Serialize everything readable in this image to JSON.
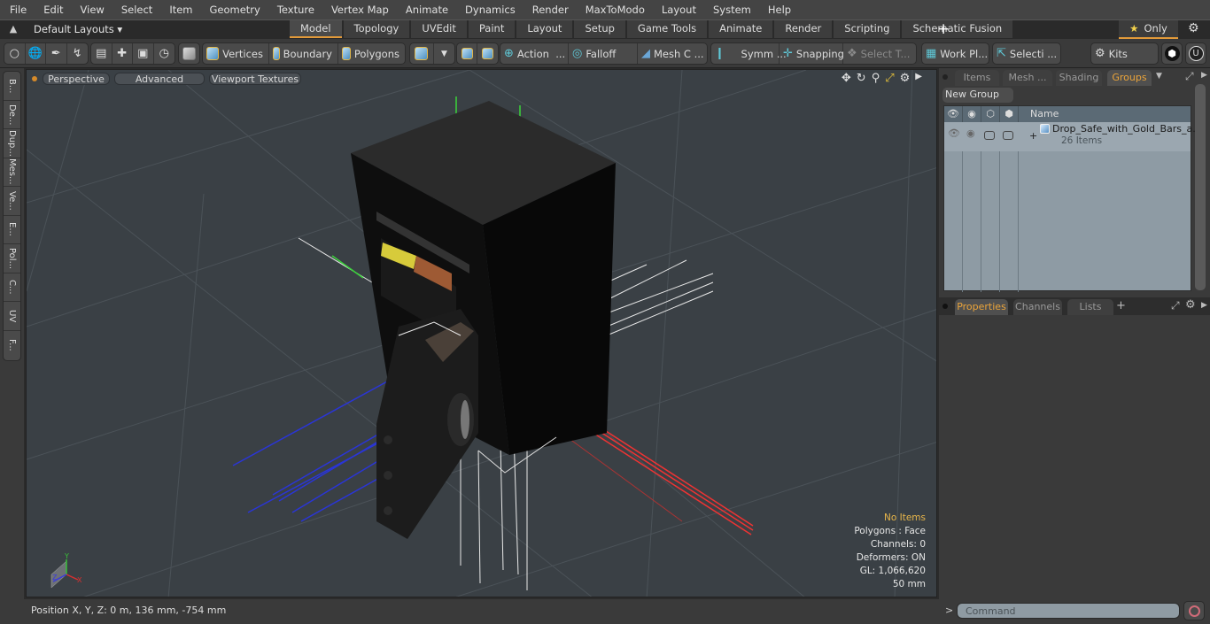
{
  "menu": [
    "File",
    "Edit",
    "View",
    "Select",
    "Item",
    "Geometry",
    "Texture",
    "Vertex Map",
    "Animate",
    "Dynamics",
    "Render",
    "MaxToModo",
    "Layout",
    "System",
    "Help"
  ],
  "layout": {
    "selector": "Default Layouts",
    "tabs": [
      "Model",
      "Topology",
      "UVEdit",
      "Paint",
      "Layout",
      "Setup",
      "Game Tools",
      "Animate",
      "Render",
      "Scripting",
      "Schematic Fusion"
    ],
    "active_tab": "Model",
    "add_tab": "+",
    "only_label": "Only"
  },
  "toolbar": {
    "vertices": "Vertices",
    "boundary": "Boundary",
    "polygons": "Polygons",
    "action": "Action",
    "falloff": "Falloff",
    "mesh_c": "Mesh C ...",
    "symm": "Symm ...",
    "snapping": "Snapping",
    "select_t": "Select T...",
    "work_pl": "Work Pl...",
    "selecti": "Selecti ...",
    "kits": "Kits",
    "ellipsis": "..."
  },
  "left_tabs": [
    "B...",
    "De...",
    "Dup...",
    "Mes...",
    "Ve...",
    "E...",
    "Pol...",
    "C...",
    "UV",
    "F..."
  ],
  "viewport": {
    "view_mode": "Perspective",
    "shading": "Advanced",
    "textures": "Viewport Textures",
    "info": {
      "items": "No Items",
      "polygons": "Polygons : Face",
      "channels": "Channels: 0",
      "deformers": "Deformers: ON",
      "gl": "GL: 1,066,620",
      "scale": "50 mm"
    },
    "axis": {
      "x": "X",
      "y": "Y",
      "z": "Z"
    }
  },
  "items_panel": {
    "tabs": [
      "Items",
      "Mesh ...",
      "Shading",
      "Groups"
    ],
    "active_tab": "Groups",
    "new_group": "New Group",
    "column_name": "Name",
    "rows": [
      {
        "name": "Drop_Safe_with_Gold_Bars_a...",
        "count": "26 Items",
        "expand": "+"
      }
    ]
  },
  "props_panel": {
    "tabs": [
      "Properties",
      "Channels",
      "Lists"
    ],
    "active_tab": "Properties",
    "add": "+"
  },
  "status": {
    "position": "Position X, Y, Z:   0 m, 136 mm, -754 mm"
  },
  "command": {
    "placeholder": "Command",
    "prompt": ">"
  }
}
